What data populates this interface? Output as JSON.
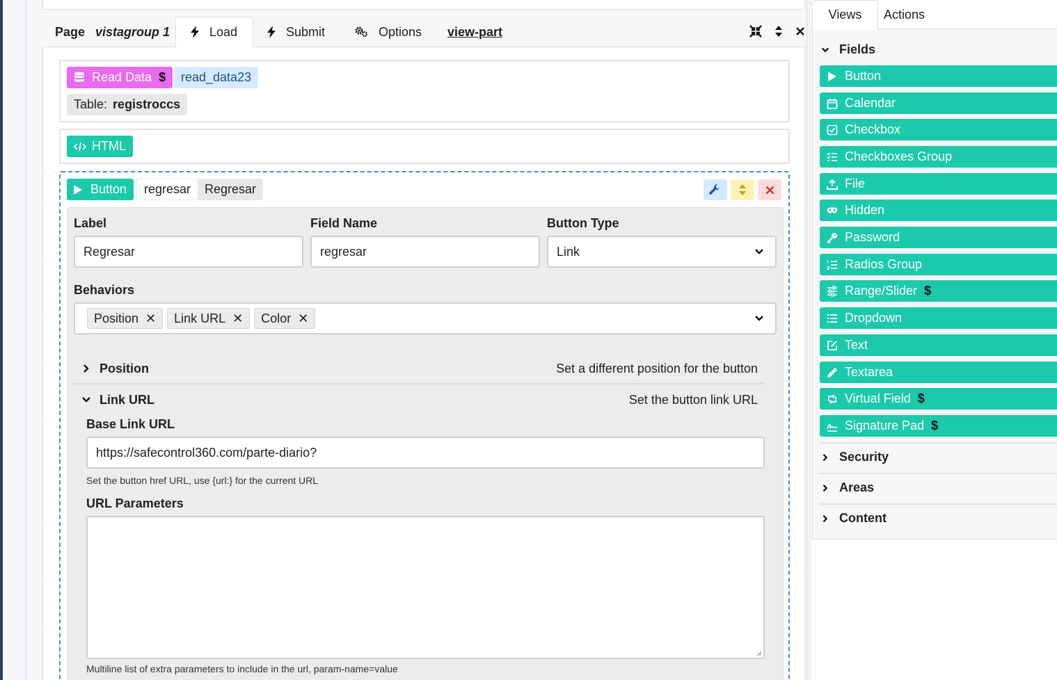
{
  "header": {
    "page_label": "Page",
    "page_name": "vistagroup 1",
    "tabs": [
      {
        "label": "Load",
        "icon": "bolt-icon",
        "active": true
      },
      {
        "label": "Submit",
        "icon": "bolt-icon"
      },
      {
        "label": "Options",
        "icon": "gears-icon"
      }
    ],
    "link": "view-part"
  },
  "read_data_block": {
    "type_label": "Read Data",
    "name": "read_data23",
    "table_label": "Table:",
    "table_name": "registroccs"
  },
  "html_block": {
    "type_label": "HTML"
  },
  "button_block": {
    "type_label": "Button",
    "field_name": "regresar",
    "label": "Regresar",
    "form": {
      "label_title": "Label",
      "label_value": "Regresar",
      "field_name_title": "Field Name",
      "field_name_value": "regresar",
      "button_type_title": "Button Type",
      "button_type_value": "Link",
      "behaviors_title": "Behaviors",
      "behaviors": [
        "Position",
        "Link URL",
        "Color"
      ],
      "sections": [
        {
          "title": "Position",
          "desc": "Set a different position for the button",
          "expanded": false
        },
        {
          "title": "Link URL",
          "desc": "Set the button link URL",
          "expanded": true
        }
      ],
      "base_link_title": "Base Link URL",
      "base_link_value": "https://safecontrol360.com/parte-diario?",
      "base_link_help": "Set the button href URL, use {url:} for the current URL",
      "url_params_title": "URL Parameters",
      "url_params_value": "",
      "url_params_help": "Multiline list of extra parameters to include in the url, param-name=value"
    }
  },
  "sidebar": {
    "tabs": [
      "Views",
      "Actions"
    ],
    "fields_title": "Fields",
    "fields": [
      {
        "label": "Button",
        "icon": "play-icon"
      },
      {
        "label": "Calendar",
        "icon": "calendar-icon"
      },
      {
        "label": "Checkbox",
        "icon": "checkbox-icon"
      },
      {
        "label": "Checkboxes Group",
        "icon": "checklist-icon"
      },
      {
        "label": "File",
        "icon": "upload-icon"
      },
      {
        "label": "Hidden",
        "icon": "mask-icon"
      },
      {
        "label": "Password",
        "icon": "key-icon"
      },
      {
        "label": "Radios Group",
        "icon": "list-ol-icon"
      },
      {
        "label": "Range/Slider",
        "icon": "sliders-icon",
        "premium": "$"
      },
      {
        "label": "Dropdown",
        "icon": "list-icon"
      },
      {
        "label": "Text",
        "icon": "edit-icon"
      },
      {
        "label": "Textarea",
        "icon": "pencil-icon"
      },
      {
        "label": "Virtual Field",
        "icon": "sync-icon",
        "premium": "$"
      },
      {
        "label": "Signature Pad",
        "icon": "signature-icon",
        "premium": "$"
      }
    ],
    "collapsed_sections": [
      "Security",
      "Areas",
      "Content"
    ]
  },
  "colors": {
    "accent_teal": "#1cc9aa",
    "accent_purple": "#e76bef",
    "dashed_blue": "#3d8fe0"
  }
}
